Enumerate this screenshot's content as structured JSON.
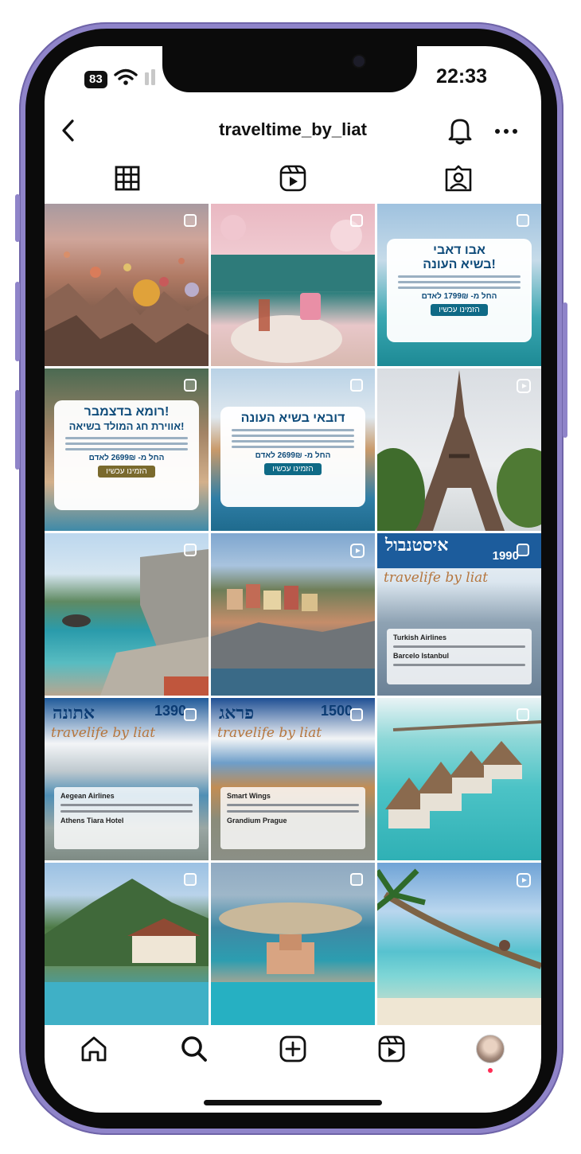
{
  "status_bar": {
    "battery": "83",
    "time": "22:33"
  },
  "header": {
    "username": "traveltime_by_liat"
  },
  "icons": {
    "back": "chevron-left-icon",
    "notifications": "bell-icon",
    "more": "more-horizontal-icon",
    "grid_tab": "grid-icon",
    "reels_tab": "reels-icon",
    "tagged_tab": "tagged-icon",
    "home": "home-icon",
    "search": "search-icon",
    "create": "plus-square-icon",
    "reels": "reels-icon",
    "profile": "profile-avatar"
  },
  "colors": {
    "frame": "#8f84c9",
    "accent_dot": "#ff2d55",
    "poster_blue": "#0e4b7a"
  },
  "posts": [
    {
      "kind": "image",
      "subject": "hot air balloons"
    },
    {
      "kind": "image",
      "subject": "flower cafe"
    },
    {
      "kind": "carousel",
      "title_line1": "אבו דאבי",
      "title_line2": "בשיא העונה!",
      "price": "החל מ- 1799₪ לאדם",
      "button": "הזמינו עכשיו"
    },
    {
      "kind": "carousel",
      "title_line1": "רומא בדצמבר!",
      "title_line2": "אווירת חג המולד בשיאה!",
      "price": "החל מ- 2699₪ לאדם",
      "button": "הזמינו עכשיו"
    },
    {
      "kind": "carousel",
      "title_line1": "דובאי בשיא העונה",
      "title_line2": "",
      "price": "החל מ- 2699₪ לאדם",
      "button": "הזמינו עכשיו"
    },
    {
      "kind": "reel",
      "subject": "eiffel tower"
    },
    {
      "kind": "image",
      "subject": "coast"
    },
    {
      "kind": "reel",
      "subject": "cinque terre"
    },
    {
      "kind": "carousel",
      "title": "איסטנבול",
      "script": "travelife by liat",
      "price": "1990",
      "airline": "Turkish Airlines",
      "hotel": "Barcelo Istanbul"
    },
    {
      "kind": "carousel",
      "title": "אתונה",
      "script": "travelife by liat",
      "price": "1390",
      "airline": "Aegean Airlines",
      "hotel": "Athens Tiara Hotel"
    },
    {
      "kind": "carousel",
      "title": "פראג",
      "script": "travelife by liat",
      "price": "1500",
      "airline": "Smart Wings",
      "hotel": "Grandium Prague"
    },
    {
      "kind": "image",
      "subject": "maldives villas"
    },
    {
      "kind": "image",
      "subject": "mountain resort"
    },
    {
      "kind": "image",
      "subject": "palm island"
    },
    {
      "kind": "reel",
      "subject": "palm beach"
    }
  ]
}
